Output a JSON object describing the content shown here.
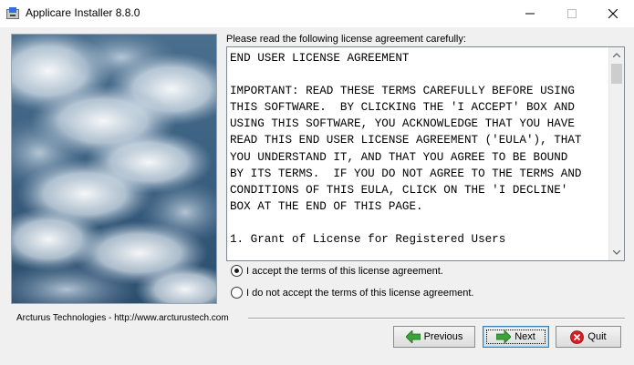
{
  "window": {
    "title": "Applicare Installer 8.8.0"
  },
  "license": {
    "caption": "Please read the following license agreement carefully:",
    "text": "END USER LICENSE AGREEMENT\n\nIMPORTANT: READ THESE TERMS CAREFULLY BEFORE USING\nTHIS SOFTWARE.  BY CLICKING THE 'I ACCEPT' BOX AND\nUSING THIS SOFTWARE, YOU ACKNOWLEDGE THAT YOU HAVE\nREAD THIS END USER LICENSE AGREEMENT ('EULA'), THAT\nYOU UNDERSTAND IT, AND THAT YOU AGREE TO BE BOUND\nBY ITS TERMS.  IF YOU DO NOT AGREE TO THE TERMS AND\nCONDITIONS OF THIS EULA, CLICK ON THE 'I DECLINE'\nBOX AT THE END OF THIS PAGE.\n\n1. Grant of License for Registered Users\n\n"
  },
  "options": {
    "accept_label": "I accept the terms of this license agreement.",
    "decline_label": "I do not accept the terms of this license agreement.",
    "selected": "accept"
  },
  "footer": {
    "company": "Arcturus Technologies - http://www.arcturustech.com"
  },
  "buttons": {
    "previous": "Previous",
    "next": "Next",
    "quit": "Quit"
  },
  "icons": {
    "app": "installer-app-icon",
    "previous": "arrow-left-icon",
    "next": "arrow-right-icon",
    "quit": "close-circle-icon"
  },
  "colors": {
    "arrow_green": "#3aa33a",
    "quit_red": "#d42020"
  }
}
